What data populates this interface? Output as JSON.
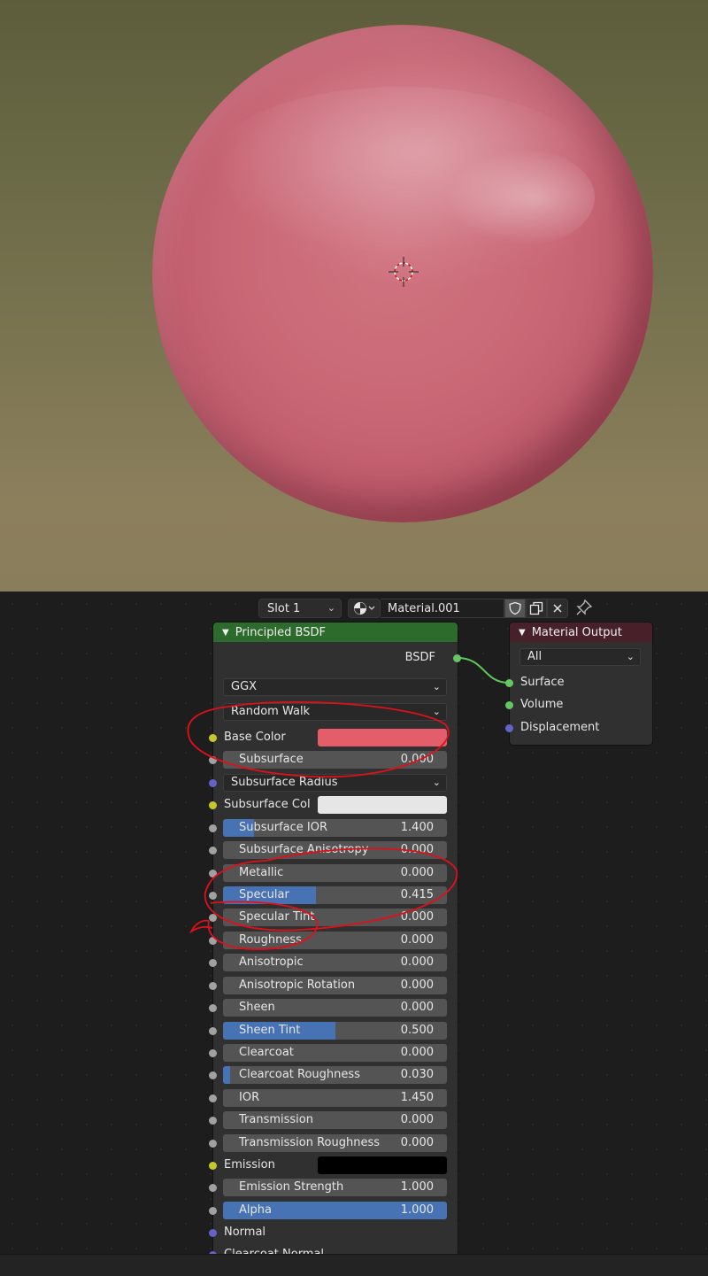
{
  "viewport": {
    "sphere_color": "#c96675"
  },
  "header": {
    "slot": "Slot 1",
    "material_name": "Material.001",
    "icons": [
      "material-sphere-icon",
      "shield-icon",
      "copy-icon",
      "close-icon",
      "pin-icon"
    ]
  },
  "bsdf": {
    "title": "Principled BSDF",
    "output": "BSDF",
    "distribution": "GGX",
    "subsurface_method": "Random Walk",
    "base_color_label": "Base Color",
    "base_color": "#e35e6a",
    "subsurface": {
      "label": "Subsurface",
      "value": "0.000",
      "fill": 0
    },
    "subsurface_radius": "Subsurface Radius",
    "subsurface_col_label": "Subsurface Col",
    "subsurface_col": "#e6e6e6",
    "subsurface_ior": {
      "label": "Subsurface IOR",
      "value": "1.400",
      "fill": 0.14
    },
    "subsurface_anisotropy": {
      "label": "Subsurface Anisotropy",
      "value": "0.000",
      "fill": 0
    },
    "metallic": {
      "label": "Metallic",
      "value": "0.000",
      "fill": 0
    },
    "specular": {
      "label": "Specular",
      "value": "0.415",
      "fill": 0.415
    },
    "specular_tint": {
      "label": "Specular Tint",
      "value": "0.000",
      "fill": 0
    },
    "roughness": {
      "label": "Roughness",
      "value": "0.000",
      "fill": 0
    },
    "anisotropic": {
      "label": "Anisotropic",
      "value": "0.000",
      "fill": 0
    },
    "anisotropic_rotation": {
      "label": "Anisotropic Rotation",
      "value": "0.000",
      "fill": 0
    },
    "sheen": {
      "label": "Sheen",
      "value": "0.000",
      "fill": 0
    },
    "sheen_tint": {
      "label": "Sheen Tint",
      "value": "0.500",
      "fill": 0.5
    },
    "clearcoat": {
      "label": "Clearcoat",
      "value": "0.000",
      "fill": 0
    },
    "clearcoat_roughness": {
      "label": "Clearcoat Roughness",
      "value": "0.030",
      "fill": 0.03
    },
    "ior": {
      "label": "IOR",
      "value": "1.450",
      "fill": 0
    },
    "transmission": {
      "label": "Transmission",
      "value": "0.000",
      "fill": 0
    },
    "transmission_roughness": {
      "label": "Transmission Roughness",
      "value": "0.000",
      "fill": 0
    },
    "emission_label": "Emission",
    "emission_color": "#000000",
    "emission_strength": {
      "label": "Emission Strength",
      "value": "1.000",
      "fill": 0
    },
    "alpha": {
      "label": "Alpha",
      "value": "1.000",
      "fill": 1
    },
    "normal_label": "Normal",
    "clearcoat_normal_label": "Clearcoat Normal"
  },
  "output_node": {
    "title": "Material Output",
    "target": "All",
    "surface": "Surface",
    "volume": "Volume",
    "displacement": "Displacement"
  },
  "colors": {
    "annotation": "#e0101a",
    "node_green": "#2c6b2c",
    "accent": "#4772b3"
  }
}
